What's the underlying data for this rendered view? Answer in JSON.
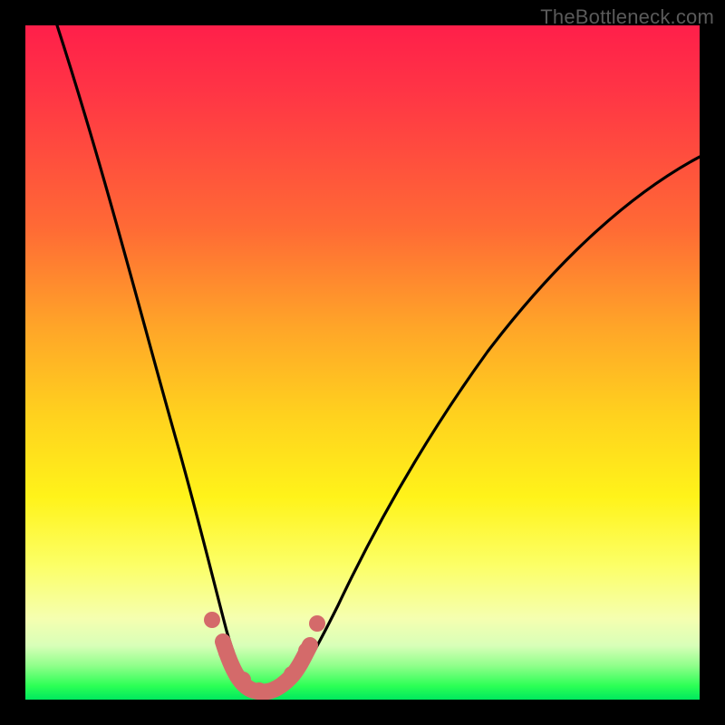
{
  "watermark": "TheBottleneck.com",
  "chart_data": {
    "type": "line",
    "title": "",
    "xlabel": "",
    "ylabel": "",
    "xlim": [
      0,
      100
    ],
    "ylim": [
      0,
      100
    ],
    "series": [
      {
        "name": "bottleneck-curve",
        "x": [
          5,
          10,
          15,
          20,
          25,
          27,
          30,
          32,
          34,
          36,
          38,
          42,
          50,
          60,
          70,
          80,
          90,
          100
        ],
        "y": [
          100,
          82,
          60,
          40,
          20,
          12,
          4,
          1,
          0,
          0,
          1,
          4,
          15,
          30,
          44,
          56,
          65,
          72
        ]
      }
    ],
    "markers": {
      "name": "highlight-dots",
      "x": [
        27.5,
        30,
        32,
        34,
        36,
        38,
        40
      ],
      "y": [
        10,
        3,
        1,
        0.5,
        0.7,
        1.5,
        9
      ],
      "color": "#d46a6a"
    },
    "colors": {
      "curve": "#000000",
      "marker": "#d46a6a",
      "gradient_top": "#ff1f4a",
      "gradient_bottom": "#00e85e"
    }
  }
}
